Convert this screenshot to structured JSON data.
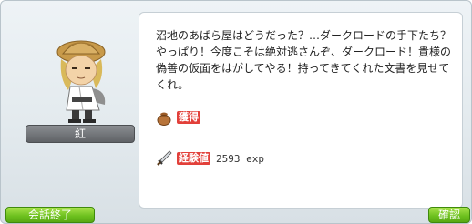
{
  "npc": {
    "name": "紅"
  },
  "dialog": {
    "text": "沼地のあばら屋はどうだった？…ダークロードの手下たち？やっぱり！今度こそは絶対逃さんぞ、ダークロード！貴様の偽善の仮面をはがしてやる！持ってきてくれた文書を見せてくれ。"
  },
  "rewards": {
    "item_label": "獲得",
    "item_icon": "pouch-icon",
    "exp_label": "経験値",
    "exp_icon": "sword-icon",
    "exp_value": "2593 exp"
  },
  "buttons": {
    "end_label": "会話終了",
    "ok_label": "確認"
  },
  "colors": {
    "button_green": "#6bbf1d",
    "label_red": "#e2403a",
    "name_plate_gray": "#6f7276"
  }
}
